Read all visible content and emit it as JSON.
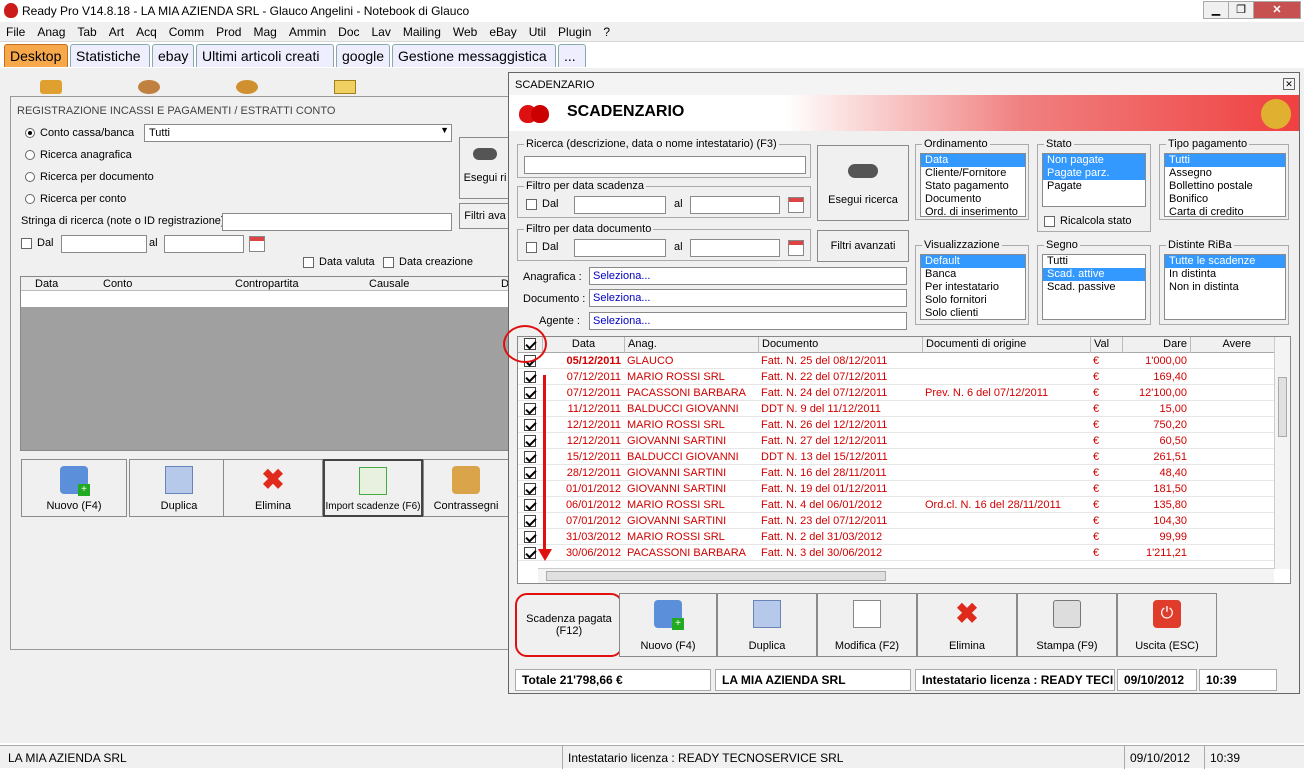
{
  "window": {
    "title": "Ready Pro V14.8.18 - LA MIA AZIENDA SRL - Glauco Angelini - Notebook di Glauco"
  },
  "menu": [
    "File",
    "Anag",
    "Tab",
    "Art",
    "Acq",
    "Comm",
    "Prod",
    "Mag",
    "Ammin",
    "Doc",
    "Lav",
    "Mailing",
    "Web",
    "eBay",
    "Util",
    "Plugin",
    "?"
  ],
  "tabs": [
    "Desktop",
    "Statistiche",
    "ebay",
    "Ultimi articoli creati",
    "google",
    "Gestione messaggistica",
    "..."
  ],
  "reg": {
    "title": "REGISTRAZIONE INCASSI E PAGAMENTI / ESTRATTI CONTO",
    "radio_conto": "Conto cassa/banca",
    "conto_value": "Tutti",
    "radio_anag": "Ricerca anagrafica",
    "radio_doc": "Ricerca per documento",
    "radio_conto2": "Ricerca per conto",
    "search_label": "Stringa di ricerca (note o ID registrazione)",
    "dal": "Dal",
    "al": "al",
    "data_valuta": "Data valuta",
    "data_creazione": "Data creazione",
    "esegui": "Esegui ri",
    "filtri": "Filtri ava",
    "cols": [
      "Data",
      "Conto",
      "Contropartita",
      "Causale",
      "D"
    ],
    "buttons": [
      "Nuovo (F4)",
      "Duplica",
      "Elimina",
      "Import scadenze (F6)",
      "Contrassegni"
    ]
  },
  "scad": {
    "wintitle": "SCADENZARIO",
    "header": "SCADENZARIO",
    "ricerca_label": "Ricerca (descrizione, data o nome intestatario) (F3)",
    "filtro_scad": "Filtro per data scadenza",
    "filtro_doc": "Filtro per data documento",
    "dal": "Dal",
    "al": "al",
    "esegui": "Esegui ricerca",
    "filtri": "Filtri avanzati",
    "anagrafica_label": "Anagrafica :",
    "documento_label": "Documento :",
    "agente_label": "Agente :",
    "seleziona": "Seleziona...",
    "ordinamento": {
      "title": "Ordinamento",
      "items": [
        "Data",
        "Cliente/Fornitore",
        "Stato pagamento",
        "Documento",
        "Ord. di inserimento"
      ]
    },
    "stato": {
      "title": "Stato",
      "items": [
        "Non pagate",
        "Pagate parz.",
        "Pagate"
      ]
    },
    "ricalcola": "Ricalcola stato",
    "tipo_pag": {
      "title": "Tipo pagamento",
      "items": [
        "Tutti",
        "Assegno",
        "Bollettino postale",
        "Bonifico",
        "Carta di credito"
      ]
    },
    "visualizzazione": {
      "title": "Visualizzazione",
      "items": [
        "Default",
        "Banca",
        "Per intestatario",
        "Solo fornitori",
        "Solo clienti"
      ]
    },
    "segno": {
      "title": "Segno",
      "items": [
        "Tutti",
        "Scad. attive",
        "Scad. passive"
      ]
    },
    "distinte": {
      "title": "Distinte RiBa",
      "items": [
        "Tutte le scadenze",
        "In distinta",
        "Non in distinta"
      ]
    },
    "cols": [
      "Data",
      "Anag.",
      "Documento",
      "Documenti di origine",
      "Val",
      "Dare",
      "Avere"
    ],
    "rows": [
      [
        "05/12/2011",
        "GLAUCO",
        "Fatt. N. 25 del 08/12/2011",
        "",
        "€",
        "1'000,00"
      ],
      [
        "07/12/2011",
        "MARIO ROSSI SRL",
        "Fatt. N. 22 del 07/12/2011",
        "",
        "€",
        "169,40"
      ],
      [
        "07/12/2011",
        "PACASSONI BARBARA",
        "Fatt. N. 24 del 07/12/2011",
        "Prev. N. 6 del 07/12/2011",
        "€",
        "12'100,00"
      ],
      [
        "11/12/2011",
        "BALDUCCI GIOVANNI",
        "DDT N. 9 del 11/12/2011",
        "",
        "€",
        "15,00"
      ],
      [
        "12/12/2011",
        "MARIO ROSSI SRL",
        "Fatt. N. 26 del 12/12/2011",
        "",
        "€",
        "750,20"
      ],
      [
        "12/12/2011",
        "GIOVANNI SARTINI",
        "Fatt. N. 27 del 12/12/2011",
        "",
        "€",
        "60,50"
      ],
      [
        "15/12/2011",
        "BALDUCCI GIOVANNI",
        "DDT N. 13 del 15/12/2011",
        "",
        "€",
        "261,51"
      ],
      [
        "28/12/2011",
        "GIOVANNI SARTINI",
        "Fatt. N. 16 del 28/11/2011",
        "",
        "€",
        "48,40"
      ],
      [
        "01/01/2012",
        "GIOVANNI SARTINI",
        "Fatt. N. 19 del 01/12/2011",
        "",
        "€",
        "181,50"
      ],
      [
        "06/01/2012",
        "MARIO ROSSI SRL",
        "Fatt. N. 4 del 06/01/2012",
        "Ord.cl. N. 16 del 28/11/2011",
        "€",
        "135,80"
      ],
      [
        "07/01/2012",
        "GIOVANNI SARTINI",
        "Fatt. N. 23 del 07/12/2011",
        "",
        "€",
        "104,30"
      ],
      [
        "31/03/2012",
        "MARIO ROSSI SRL",
        "Fatt. N. 2 del 31/03/2012",
        "",
        "€",
        "99,99"
      ],
      [
        "30/06/2012",
        "PACASSONI BARBARA",
        "Fatt. N. 3 del 30/06/2012",
        "",
        "€",
        "1'211,21"
      ]
    ],
    "buttons": [
      "Scadenza pagata (F12)",
      "Nuovo (F4)",
      "Duplica",
      "Modifica (F2)",
      "Elimina",
      "Stampa (F9)",
      "Uscita (ESC)"
    ],
    "status": {
      "totale": "Totale 21'798,66 €",
      "azienda": "LA MIA AZIENDA SRL",
      "licenza": "Intestatario licenza : READY TECI",
      "date": "09/10/2012",
      "time": "10:39"
    }
  },
  "bottom": {
    "azienda": "LA MIA AZIENDA SRL",
    "licenza": "Intestatario licenza : READY TECNOSERVICE SRL",
    "date": "09/10/2012",
    "time": "10:39"
  },
  "colors": {
    "accent_tab": "#f7a84a",
    "row_text": "#d00000",
    "selection": "#3399ff",
    "annotation": "#e01010"
  }
}
